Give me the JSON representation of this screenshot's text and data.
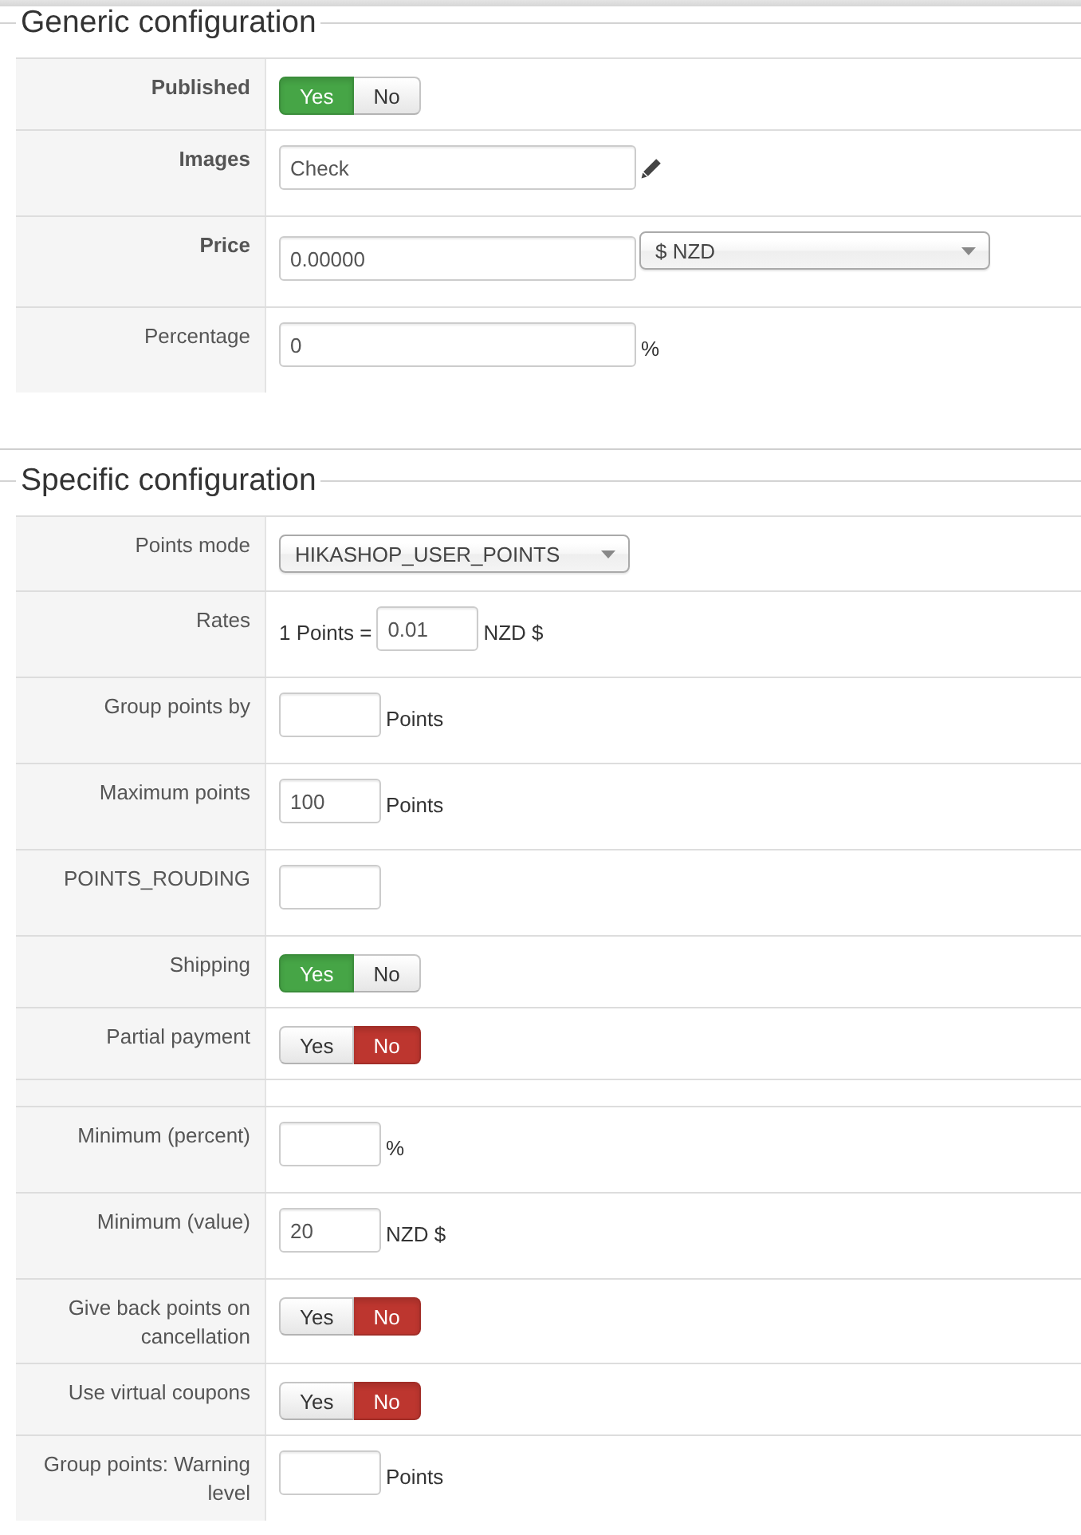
{
  "sections": [
    {
      "title": "Generic configuration",
      "rows": [
        {
          "label": "Published",
          "bold": true,
          "kind": "toggle",
          "options": [
            {
              "label": "Yes",
              "selected": true
            },
            {
              "label": "No",
              "selected": false
            }
          ]
        },
        {
          "label": "Images",
          "bold": true,
          "kind": "picker",
          "value": "Check",
          "wide": true
        },
        {
          "label": "Price",
          "bold": true,
          "kind": "input",
          "value": "0.00000",
          "wide": true,
          "select": "$ NZD"
        },
        {
          "label": "Percentage",
          "bold": false,
          "kind": "input",
          "value": "0",
          "wide": true,
          "suffix": "%"
        }
      ]
    },
    {
      "title": "Specific configuration",
      "rows": [
        {
          "label": "Points mode",
          "bold": false,
          "kind": "select",
          "value": "HIKASHOP_USER_POINTS"
        },
        {
          "label": "Rates",
          "bold": false,
          "kind": "input",
          "prefix": "1 Points =",
          "value": "0.01",
          "wide": false,
          "suffix": "NZD $"
        },
        {
          "label": "Group points by",
          "bold": false,
          "kind": "input",
          "wide": false,
          "suffix": "Points"
        },
        {
          "label": "Maximum points",
          "bold": false,
          "kind": "input",
          "value": "100",
          "wide": false,
          "suffix": "Points"
        },
        {
          "label": "POINTS_ROUDING",
          "bold": false,
          "kind": "input",
          "wide": false
        },
        {
          "label": "Shipping",
          "bold": false,
          "kind": "toggle",
          "options": [
            {
              "label": "Yes",
              "selected": true
            },
            {
              "label": "No",
              "selected": false
            }
          ]
        },
        {
          "label": "Partial payment",
          "bold": false,
          "kind": "toggle",
          "options": [
            {
              "label": "Yes",
              "selected": false
            },
            {
              "label": "No",
              "selected": true
            }
          ]
        },
        {
          "kind": "spacer"
        },
        {
          "label": "Minimum (percent)",
          "bold": false,
          "kind": "input",
          "wide": false,
          "suffix": "%"
        },
        {
          "label": "Minimum (value)",
          "bold": false,
          "kind": "input",
          "value": "20",
          "wide": false,
          "suffix": "NZD $"
        },
        {
          "label": "Give back points on cancellation",
          "bold": false,
          "kind": "toggle",
          "options": [
            {
              "label": "Yes",
              "selected": false
            },
            {
              "label": "No",
              "selected": true
            }
          ]
        },
        {
          "label": "Use virtual coupons",
          "bold": false,
          "kind": "toggle",
          "options": [
            {
              "label": "Yes",
              "selected": false
            },
            {
              "label": "No",
              "selected": true
            }
          ]
        },
        {
          "label": "Group points: Warning level",
          "bold": false,
          "kind": "input",
          "wide": false,
          "suffix": "Points"
        }
      ]
    }
  ]
}
